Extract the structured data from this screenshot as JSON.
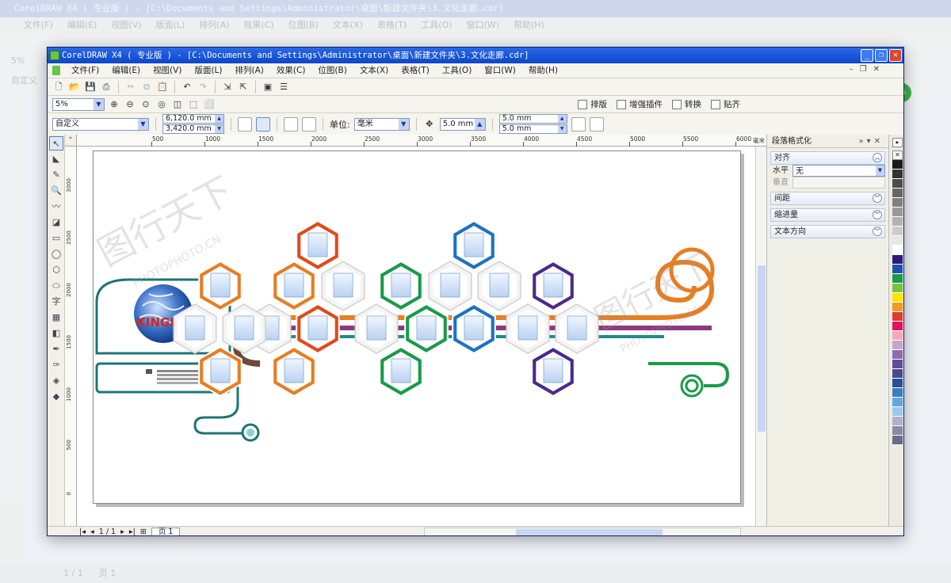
{
  "background_window": {
    "title": "CorelDRAW X4 ( 专业版 ) - [C:\\Documents and Settings\\Administrator\\桌面\\新建文件夹\\3.文化走廊.cdr]",
    "menu": [
      "文件(F)",
      "编辑(E)",
      "视图(V)",
      "版面(L)",
      "排列(A)",
      "效果(C)",
      "位图(B)",
      "文本(X)",
      "表格(T)",
      "工具(O)",
      "窗口(W)",
      "帮助(H)"
    ],
    "zoom": "5%",
    "page_size": "自定义",
    "page_counter": "1 / 1",
    "page_tab": "页 1"
  },
  "window": {
    "title": "CorelDRAW X4 ( 专业版 ) - [C:\\Documents and Settings\\Administrator\\桌面\\新建文件夹\\3.文化走廊.cdr]",
    "buttons": [
      "_",
      "❐",
      "✕"
    ]
  },
  "menu": [
    "文件(F)",
    "编辑(E)",
    "视图(V)",
    "版面(L)",
    "排列(A)",
    "效果(C)",
    "位图(B)",
    "文本(X)",
    "表格(T)",
    "工具(O)",
    "窗口(W)",
    "帮助(H)"
  ],
  "zoom_toolbar": {
    "zoom": "5%",
    "right_items": [
      "排版",
      "增强插件",
      "转换",
      "贴齐"
    ]
  },
  "property_bar": {
    "page_size": "自定义",
    "width": "6,120.0 mm",
    "height": "3,420.0 mm",
    "unit_label": "单位:",
    "unit": "毫米",
    "nudge": "5.0 mm",
    "dup_x": "5.0 mm",
    "dup_y": "5.0 mm"
  },
  "ruler": {
    "unit": "毫米",
    "h_ticks": [
      "500",
      "1000",
      "1500",
      "2000",
      "2500",
      "3000",
      "3500",
      "4000",
      "4500",
      "5000",
      "5500",
      "6000"
    ],
    "v_ticks": [
      "3000",
      "2500",
      "2000",
      "1500",
      "1000",
      "500",
      "0"
    ]
  },
  "artwork": {
    "logo_text": "KINGHO",
    "watermark_main": "图行天下",
    "watermark_sub": "PHOTOPHOTO.CN"
  },
  "docker": {
    "title": "段落格式化",
    "sections": [
      {
        "label": "对齐",
        "state": "expanded"
      },
      {
        "label": "间距",
        "state": "collapsed"
      },
      {
        "label": "缩进量",
        "state": "collapsed"
      },
      {
        "label": "文本方向",
        "state": "collapsed"
      }
    ],
    "align_horizontal_label": "水平",
    "align_horizontal_value": "无",
    "align_vertical_label": "垂直"
  },
  "palette_colors": [
    "#1a1a1a",
    "#333333",
    "#4d4d4d",
    "#666666",
    "#808080",
    "#999999",
    "#b3b3b3",
    "#cccccc",
    "#e6e6e6",
    "#ffffff",
    "#2e1a7a",
    "#1f4fb0",
    "#1a9a4a",
    "#7ac143",
    "#ffe600",
    "#f29a1f",
    "#e23a2e",
    "#e0135f",
    "#f7a8b8",
    "#c9a3cf",
    "#8e6bb0",
    "#5e4e9c",
    "#4a4a8a",
    "#2a4e9a",
    "#3b7cc4",
    "#5fa8e0",
    "#9bc8ea",
    "#b0b0c8",
    "#8a8aa8",
    "#6a6a8a"
  ],
  "status": {
    "page_counter": "1 / 1",
    "page_tab": "页 1"
  },
  "side_badge": "56"
}
